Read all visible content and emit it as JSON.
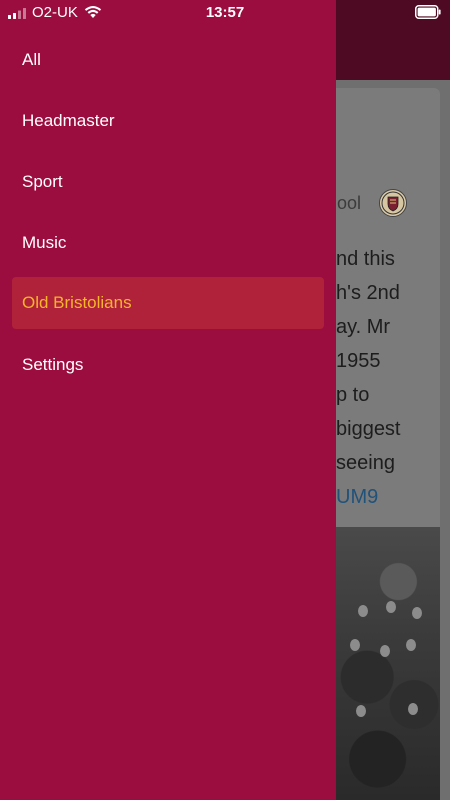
{
  "status_bar": {
    "carrier": "O2-UK",
    "time": "13:57",
    "signal_icon": "signal-bars-icon",
    "wifi_icon": "wifi-icon",
    "battery_icon": "battery-icon"
  },
  "drawer": {
    "background_color": "#9c0d3f",
    "active_color": "#f5b52b",
    "items": [
      {
        "label": "All",
        "active": false
      },
      {
        "label": "Headmaster",
        "active": false
      },
      {
        "label": "Sport",
        "active": false
      },
      {
        "label": "Music",
        "active": false
      },
      {
        "label": "Old Bristolians",
        "active": true
      },
      {
        "label": "Settings",
        "active": false
      }
    ]
  },
  "background_post": {
    "author_fragment": "hool",
    "avatar_icon": "school-crest-icon",
    "text_lines": [
      "nd this",
      "h's 2nd",
      "ay. Mr",
      "1955",
      "p to",
      "biggest",
      "seeing"
    ],
    "link_fragment": "UM9"
  }
}
